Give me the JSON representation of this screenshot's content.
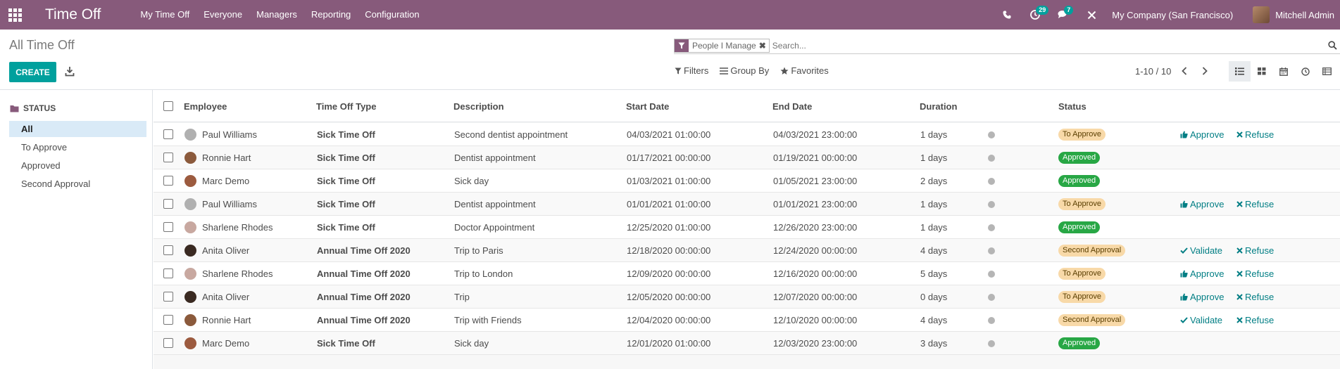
{
  "app": {
    "title": "Time Off",
    "menu": [
      "My Time Off",
      "Everyone",
      "Managers",
      "Reporting",
      "Configuration"
    ],
    "activity_count": "29",
    "messages_count": "7",
    "company": "My Company (San Francisco)",
    "user": "Mitchell Admin"
  },
  "control_panel": {
    "breadcrumb": "All Time Off",
    "facet_label": "People I Manage",
    "search_placeholder": "Search...",
    "create_label": "CREATE",
    "filters_label": "Filters",
    "groupby_label": "Group By",
    "favorites_label": "Favorites",
    "pager": "1-10 / 10"
  },
  "sidebar": {
    "title": "STATUS",
    "items": [
      {
        "label": "All",
        "active": true
      },
      {
        "label": "To Approve",
        "active": false
      },
      {
        "label": "Approved",
        "active": false
      },
      {
        "label": "Second Approval",
        "active": false
      }
    ]
  },
  "table": {
    "columns": {
      "employee": "Employee",
      "type": "Time Off Type",
      "description": "Description",
      "start": "Start Date",
      "end": "End Date",
      "duration": "Duration",
      "status": "Status"
    },
    "rows": [
      {
        "employee": "Paul Williams",
        "avatar": "#b0b0b0",
        "type": "Sick Time Off",
        "description": "Second dentist appointment",
        "start": "04/03/2021 01:00:00",
        "end": "04/03/2021 23:00:00",
        "duration": "1 days",
        "status": "To Approve",
        "status_kind": "toapprove",
        "actions": [
          "Approve",
          "Refuse"
        ]
      },
      {
        "employee": "Ronnie Hart",
        "avatar": "#8b5a3c",
        "type": "Sick Time Off",
        "description": "Dentist appointment",
        "start": "01/17/2021 00:00:00",
        "end": "01/19/2021 00:00:00",
        "duration": "1 days",
        "status": "Approved",
        "status_kind": "approved",
        "actions": []
      },
      {
        "employee": "Marc Demo",
        "avatar": "#9c5b3f",
        "type": "Sick Time Off",
        "description": "Sick day",
        "start": "01/03/2021 01:00:00",
        "end": "01/05/2021 23:00:00",
        "duration": "2 days",
        "status": "Approved",
        "status_kind": "approved",
        "actions": []
      },
      {
        "employee": "Paul Williams",
        "avatar": "#b0b0b0",
        "type": "Sick Time Off",
        "description": "Dentist appointment",
        "start": "01/01/2021 01:00:00",
        "end": "01/01/2021 23:00:00",
        "duration": "1 days",
        "status": "To Approve",
        "status_kind": "toapprove",
        "actions": [
          "Approve",
          "Refuse"
        ]
      },
      {
        "employee": "Sharlene Rhodes",
        "avatar": "#c8a8a0",
        "type": "Sick Time Off",
        "description": "Doctor Appointment",
        "start": "12/25/2020 01:00:00",
        "end": "12/26/2020 23:00:00",
        "duration": "1 days",
        "status": "Approved",
        "status_kind": "approved",
        "actions": []
      },
      {
        "employee": "Anita Oliver",
        "avatar": "#3a2a22",
        "type": "Annual Time Off 2020",
        "description": "Trip to Paris",
        "start": "12/18/2020 00:00:00",
        "end": "12/24/2020 00:00:00",
        "duration": "4 days",
        "status": "Second Approval",
        "status_kind": "second",
        "actions": [
          "Validate",
          "Refuse"
        ]
      },
      {
        "employee": "Sharlene Rhodes",
        "avatar": "#c8a8a0",
        "type": "Annual Time Off 2020",
        "description": "Trip to London",
        "start": "12/09/2020 00:00:00",
        "end": "12/16/2020 00:00:00",
        "duration": "5 days",
        "status": "To Approve",
        "status_kind": "toapprove",
        "actions": [
          "Approve",
          "Refuse"
        ]
      },
      {
        "employee": "Anita Oliver",
        "avatar": "#3a2a22",
        "type": "Annual Time Off 2020",
        "description": "Trip",
        "start": "12/05/2020 00:00:00",
        "end": "12/07/2020 00:00:00",
        "duration": "0 days",
        "status": "To Approve",
        "status_kind": "toapprove",
        "actions": [
          "Approve",
          "Refuse"
        ]
      },
      {
        "employee": "Ronnie Hart",
        "avatar": "#8b5a3c",
        "type": "Annual Time Off 2020",
        "description": "Trip with Friends",
        "start": "12/04/2020 00:00:00",
        "end": "12/10/2020 00:00:00",
        "duration": "4 days",
        "status": "Second Approval",
        "status_kind": "second",
        "actions": [
          "Validate",
          "Refuse"
        ]
      },
      {
        "employee": "Marc Demo",
        "avatar": "#9c5b3f",
        "type": "Sick Time Off",
        "description": "Sick day",
        "start": "12/01/2020 01:00:00",
        "end": "12/03/2020 23:00:00",
        "duration": "3 days",
        "status": "Approved",
        "status_kind": "approved",
        "actions": []
      }
    ]
  }
}
